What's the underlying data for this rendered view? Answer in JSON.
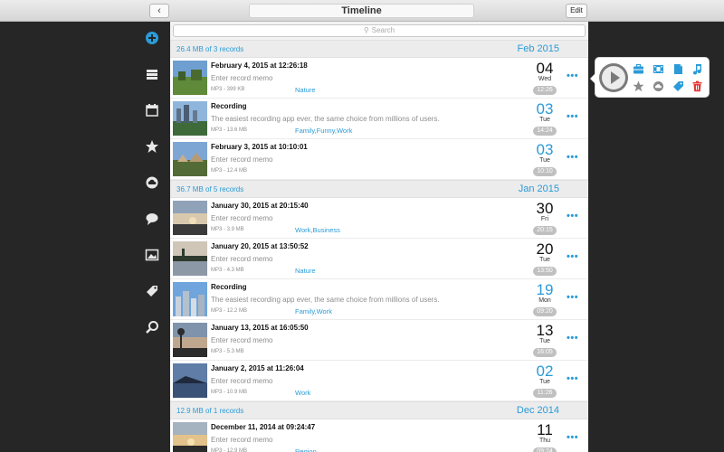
{
  "toolbar": {
    "back_label": "‹",
    "title": "Timeline",
    "edit_label": "Edit"
  },
  "search": {
    "placeholder": "Search"
  },
  "colors": {
    "accent": "#2a9bd8",
    "sidebar_bg": "#262626",
    "time_badge": "#c0c0c0",
    "trash": "#e53935"
  },
  "sidebar": {
    "icons": [
      "add-icon",
      "list-icon",
      "calendar-icon",
      "star-icon",
      "cloud-icon",
      "chat-icon",
      "photo-icon",
      "tag-icon",
      "search-icon"
    ]
  },
  "sections": [
    {
      "summary": "26.4 MB of 3 records",
      "month": "Feb 2015",
      "records": [
        {
          "title": "February 4, 2015 at 12:26:18",
          "memo": "Enter record memo",
          "meta": "MP3 -   399 KB",
          "tags": "Nature",
          "day": "04",
          "day_color": "black",
          "weekday": "Wed",
          "time": "12:26",
          "thumb": "field"
        },
        {
          "title": "Recording",
          "memo": "The easiest recording app ever, the same choice from millions of users.",
          "meta": "MP3 -   13.6 MB",
          "tags": "Family,Funny,Work",
          "day": "03",
          "day_color": "blue",
          "weekday": "Tue",
          "time": "14:24",
          "thumb": "city"
        },
        {
          "title": "February 3, 2015 at 10:10:01",
          "memo": "Enter record memo",
          "meta": "MP3 -   12.4 MB",
          "tags": "",
          "day": "03",
          "day_color": "blue",
          "weekday": "Tue",
          "time": "10:10",
          "thumb": "village"
        }
      ]
    },
    {
      "summary": "36.7 MB of 5 records",
      "month": "Jan 2015",
      "records": [
        {
          "title": "January 30, 2015 at 20:15:40",
          "memo": "Enter record memo",
          "meta": "MP3 -   3.9 MB",
          "tags": "Work,Business",
          "day": "30",
          "day_color": "black",
          "weekday": "Fri",
          "time": "20:15",
          "thumb": "sunset"
        },
        {
          "title": "January 20, 2015 at 13:50:52",
          "memo": "Enter record memo",
          "meta": "MP3 -   4.3 MB",
          "tags": "Nature",
          "day": "20",
          "day_color": "black",
          "weekday": "Tue",
          "time": "13:50",
          "thumb": "lake"
        },
        {
          "title": "Recording",
          "memo": "The easiest recording app ever, the same choice from millions of users.",
          "meta": "MP3 -   12.2 MB",
          "tags": "Family,Work",
          "day": "19",
          "day_color": "blue",
          "weekday": "Mon",
          "time": "09:20",
          "thumb": "skyline"
        },
        {
          "title": "January 13, 2015 at 16:05:50",
          "memo": "Enter record memo",
          "meta": "MP3 -   5.3 MB",
          "tags": "",
          "day": "13",
          "day_color": "black",
          "weekday": "Tue",
          "time": "16:05",
          "thumb": "dusk"
        },
        {
          "title": "January 2, 2015 at 11:26:04",
          "memo": "Enter record memo",
          "meta": "MP3 -   10.9 MB",
          "tags": "Work",
          "day": "02",
          "day_color": "blue",
          "weekday": "Tue",
          "time": "11:26",
          "thumb": "coast"
        }
      ]
    },
    {
      "summary": "12.9 MB of 1 records",
      "month": "Dec 2014",
      "records": [
        {
          "title": "December 11, 2014 at 09:24:47",
          "memo": "Enter record memo",
          "meta": "MP3 -   12.9 MB",
          "tags": "Region",
          "day": "11",
          "day_color": "black",
          "weekday": "Thu",
          "time": "09:24",
          "thumb": "sunset2"
        }
      ]
    }
  ],
  "popover": {
    "icons": [
      "briefcase-icon",
      "film-icon",
      "document-icon",
      "music-icon",
      "star-icon",
      "cloud-icon",
      "tag-icon",
      "trash-icon"
    ]
  }
}
